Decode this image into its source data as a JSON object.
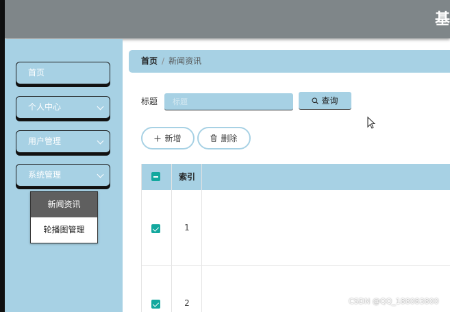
{
  "header": {
    "title": "基"
  },
  "sidebar": {
    "items": [
      {
        "label": "首页"
      },
      {
        "label": "个人中心"
      },
      {
        "label": "用户管理"
      },
      {
        "label": "系统管理"
      }
    ],
    "submenu": [
      {
        "label": "新闻资讯",
        "active": true
      },
      {
        "label": "轮播图管理",
        "active": false
      }
    ]
  },
  "breadcrumb": {
    "home": "首页",
    "current": "新闻资讯"
  },
  "search": {
    "label": "标题",
    "placeholder": "标题",
    "button_label": "查询"
  },
  "actions": {
    "add_label": "新增",
    "delete_label": "删除"
  },
  "table": {
    "headers": {
      "index": "索引"
    },
    "rows": [
      {
        "index": "1",
        "checked": true
      },
      {
        "index": "2",
        "checked": true
      }
    ]
  },
  "watermark": "CSDN @QQ_188083800",
  "colors": {
    "accent": "#a7d1e4",
    "checkbox": "#13a89e",
    "topbar": "#7f8689"
  }
}
